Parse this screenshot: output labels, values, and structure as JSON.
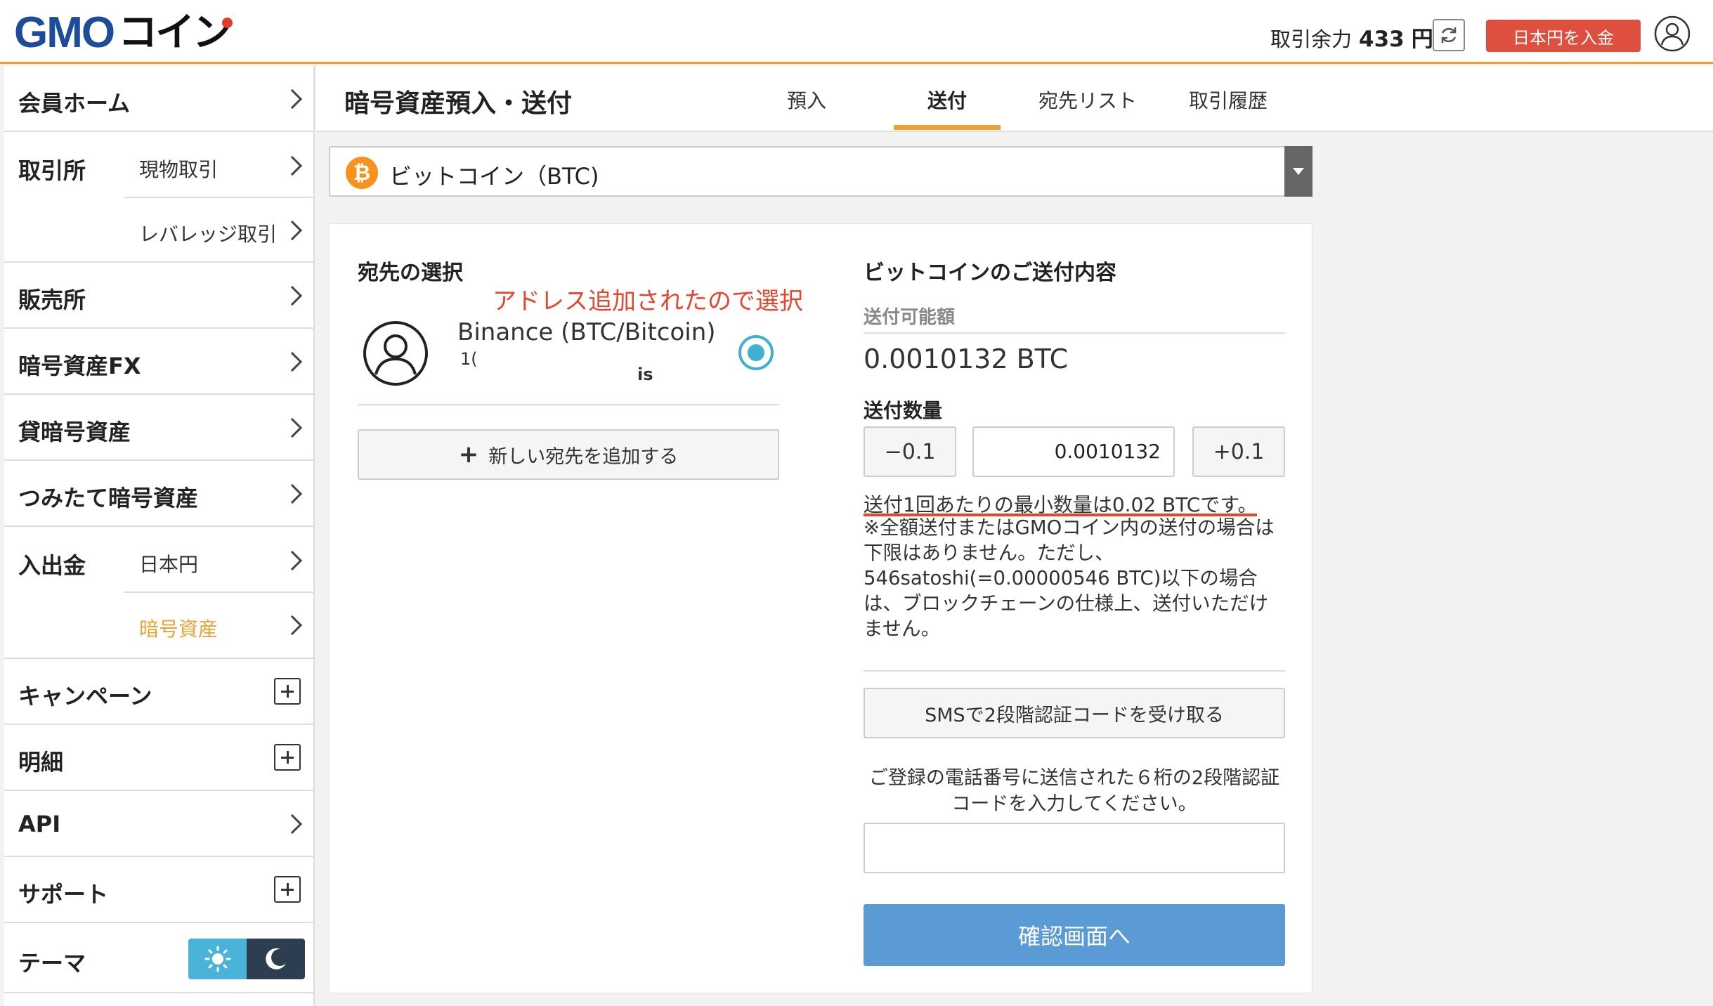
{
  "header": {
    "logo_gmo": "GMO",
    "logo_coin": "コイン",
    "balance_label": "取引余力",
    "balance_value": "433",
    "balance_unit": "円",
    "deposit_button": "日本円を入金",
    "icons": {
      "refresh": "refresh-icon",
      "user": "user-icon"
    },
    "accent_color": "#f0a030",
    "deposit_color": "#df4f3d"
  },
  "sidebar": {
    "items": [
      {
        "label": "会員ホーム"
      },
      {
        "label": "取引所",
        "subs": [
          "現物取引",
          "レバレッジ取引"
        ]
      },
      {
        "label": "販売所"
      },
      {
        "label": "暗号資産FX"
      },
      {
        "label": "貸暗号資産"
      },
      {
        "label": "つみたて暗号資産"
      },
      {
        "label": "入出金",
        "subs": [
          "日本円",
          "暗号資産"
        ],
        "active_sub": "暗号資産"
      },
      {
        "label": "キャンペーン"
      },
      {
        "label": "明細"
      },
      {
        "label": "API"
      },
      {
        "label": "サポート"
      },
      {
        "label": "テーマ"
      }
    ],
    "theme_toggle": {
      "light_icon": "sun-icon",
      "dark_icon": "moon-icon",
      "light_color": "#4ab4d8",
      "dark_color": "#2c3e50"
    }
  },
  "page": {
    "title": "暗号資産預入・送付",
    "tabs": [
      "預入",
      "送付",
      "宛先リスト",
      "取引履歴"
    ],
    "active_tab": "送付"
  },
  "currency_select": {
    "value": "ビットコイン（BTC)",
    "icon": "bitcoin-icon",
    "icon_glyph": "₿",
    "icon_color": "#f7931a"
  },
  "destination": {
    "title": "宛先の選択",
    "annotation": "アドレス追加されたので選択",
    "address_name": "Binance (BTC/Bitcoin)",
    "address_fragment_1": "1(",
    "address_fragment_2": "is",
    "add_button": "新しい宛先を追加する",
    "add_button_plus": "+"
  },
  "send": {
    "title": "ビットコインのご送付内容",
    "available_label": "送付可能額",
    "available_value": "0.0010132 BTC",
    "quantity_label": "送付数量",
    "minus_button": "−0.1",
    "quantity_value": "0.0010132",
    "plus_button": "+0.1",
    "min_note": "送付1回あたりの最小数量は0.02 BTCです。",
    "note": "※全額送付またはGMOコイン内の送付の場合は下限はありません。ただし、546satoshi(=0.00000546 BTC)以下の場合は、ブロックチェーンの仕様上、送付いただけません。",
    "sms_button": "SMSで2段階認証コードを受け取る",
    "sms_note": "ご登録の電話番号に送信された６桁の2段階認証コードを入力してください。",
    "code_placeholder": "",
    "confirm_button": "確認画面へ",
    "confirm_color": "#5b9bd5",
    "annotation_color": "#e8452f"
  }
}
